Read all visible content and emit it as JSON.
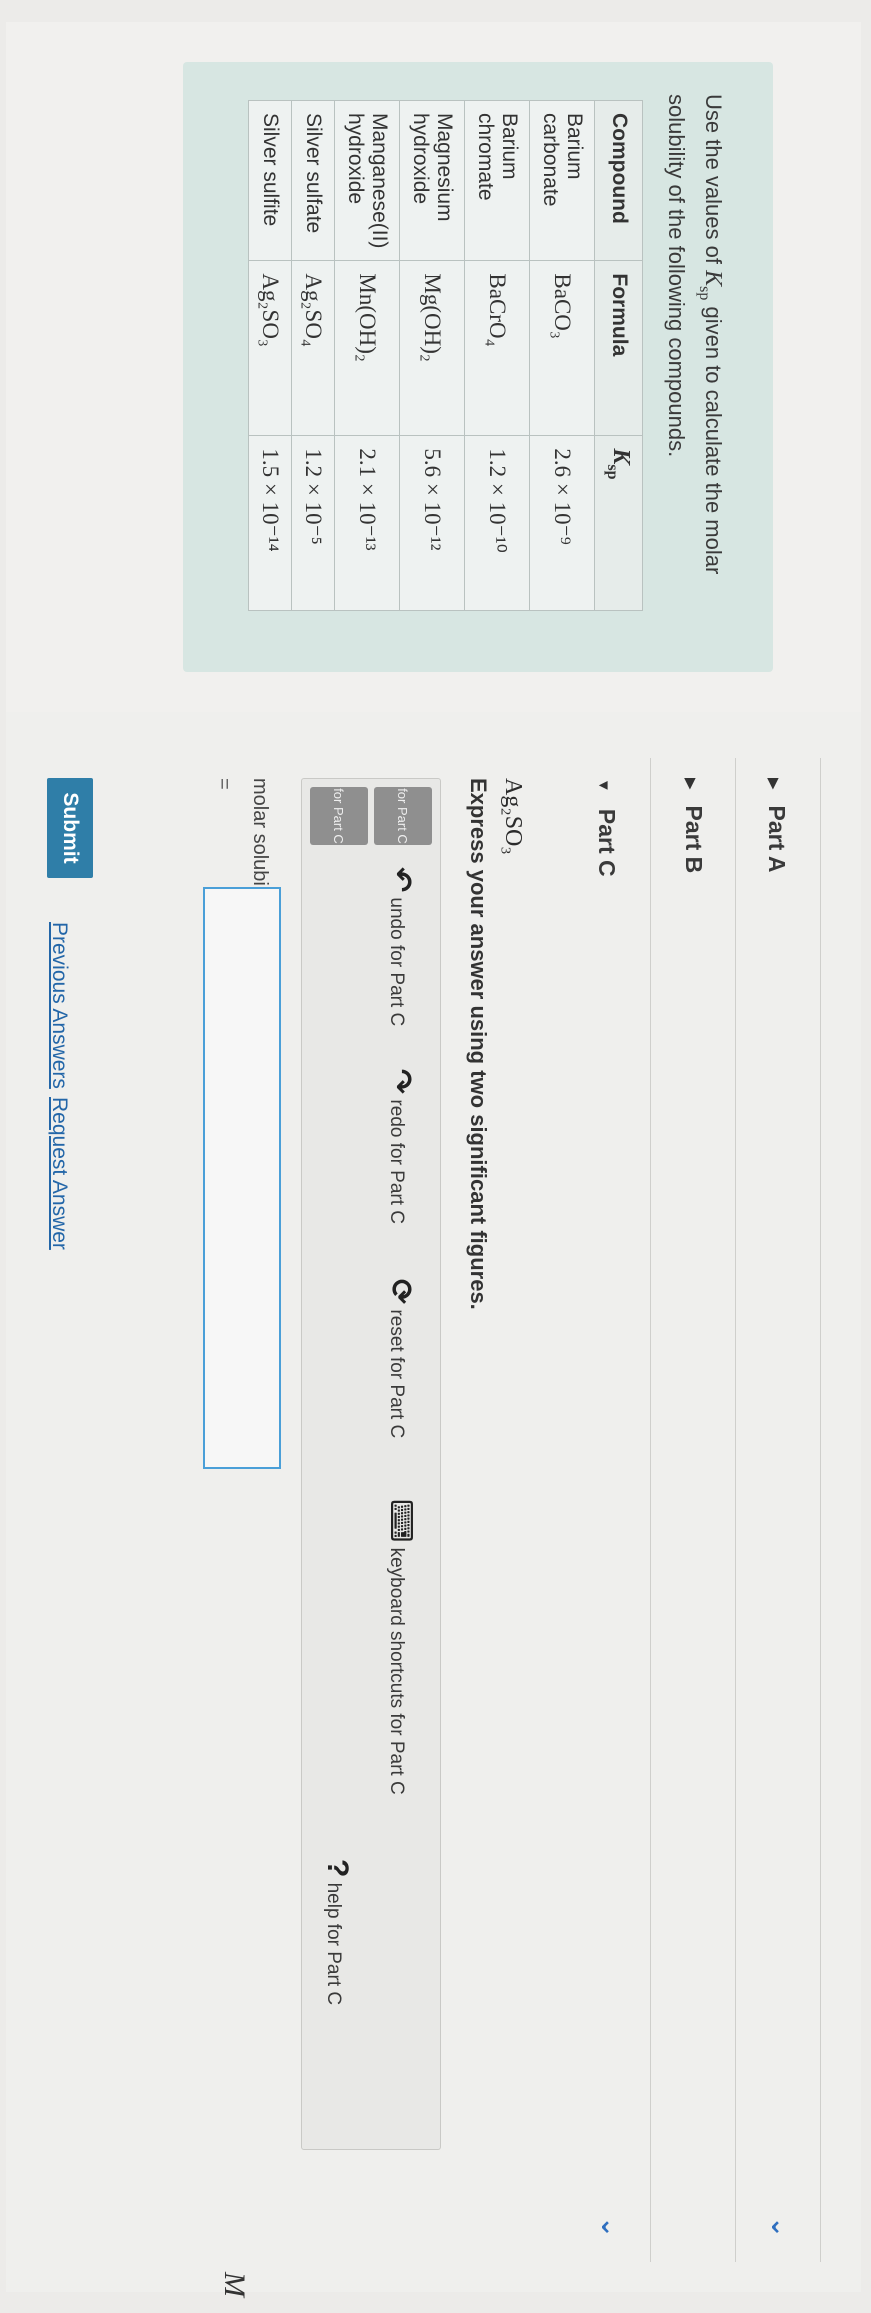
{
  "intro": {
    "text_before": "Use the values of",
    "ksp_symbol": "K",
    "ksp_sub": "sp",
    "text_after": "given to calculate the molar solubility of the following compounds."
  },
  "table": {
    "headers": [
      "Compound",
      "Formula",
      "Ksp"
    ],
    "rows": [
      {
        "compound": "Barium carbonate",
        "formula": "BaCO₃",
        "ksp": "2.6 × 10⁻⁹"
      },
      {
        "compound": "Barium chromate",
        "formula": "BaCrO₄",
        "ksp": "1.2 × 10⁻¹⁰"
      },
      {
        "compound": "Magnesium hydroxide",
        "formula": "Mg(OH)₂",
        "ksp": "5.6 × 10⁻¹²"
      },
      {
        "compound": "Manganese(II) hydroxide",
        "formula": "Mn(OH)₂",
        "ksp": "2.1 × 10⁻¹³"
      },
      {
        "compound": "Silver sulfate",
        "formula": "Ag₂SO₄",
        "ksp": "1.2 × 10⁻⁵"
      },
      {
        "compound": "Silver sulfite",
        "formula": "Ag₂SO₃",
        "ksp": "1.5 × 10⁻¹⁴"
      }
    ]
  },
  "parts": {
    "a": "Part A",
    "b": "Part B",
    "c": "Part C"
  },
  "part_c": {
    "formula": "Ag₂SO₃",
    "instruction": "Express your answer using two significant figures.",
    "toolbar": {
      "btn1": "for Part C",
      "btn2": "for Part C",
      "undo": "undo for Part C",
      "redo": "redo for Part C",
      "reset": "reset for Part C",
      "shortcuts": "keyboard shortcuts for Part C",
      "help": "help for Part C"
    },
    "answer_label": "molar solubility",
    "equals": "=",
    "unit": "M",
    "submit": "Submit",
    "previous_answers": "Previous Answers",
    "request_answer": "Request Answer"
  }
}
